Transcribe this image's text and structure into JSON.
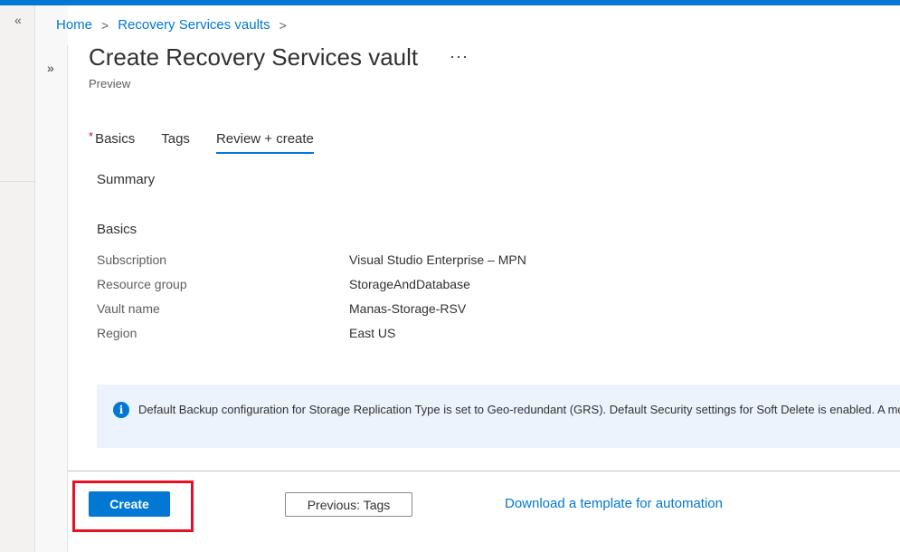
{
  "breadcrumb": {
    "home": "Home",
    "vaults": "Recovery Services vaults",
    "separator": ">"
  },
  "page": {
    "title": "Create Recovery Services vault",
    "subtitle": "Preview",
    "more": "···"
  },
  "nav": {
    "collapse": "«",
    "expand": "»"
  },
  "tabs": [
    {
      "label": "Basics",
      "required_marker": "*"
    },
    {
      "label": "Tags"
    },
    {
      "label": "Review + create",
      "active": true
    }
  ],
  "summary": {
    "heading": "Summary",
    "basics_heading": "Basics",
    "rows": [
      {
        "label": "Subscription",
        "value": "Visual Studio Enterprise – MPN"
      },
      {
        "label": "Resource group",
        "value": "StorageAndDatabase"
      },
      {
        "label": "Vault name",
        "value": "Manas-Storage-RSV"
      },
      {
        "label": "Region",
        "value": "East US"
      }
    ]
  },
  "info": {
    "icon": "i",
    "text": "Default Backup configuration for Storage Replication Type is set to Geo-redundant (GRS). Default Security settings for Soft Delete is enabled. A more."
  },
  "footer": {
    "create_label": "Create",
    "previous_label": "Previous: Tags",
    "download_link": "Download a template for automation"
  },
  "colors": {
    "accent": "#0078d4",
    "highlight": "#e81123",
    "info_bg": "#ebf3fc"
  }
}
